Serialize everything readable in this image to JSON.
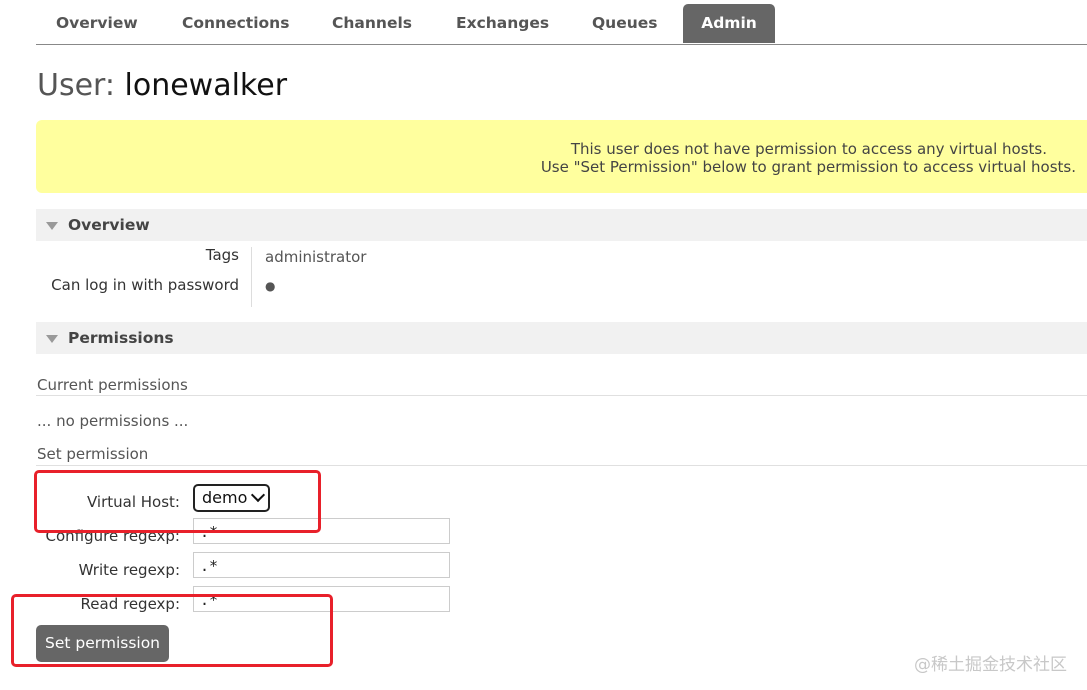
{
  "nav": {
    "tabs": [
      "Overview",
      "Connections",
      "Channels",
      "Exchanges",
      "Queues",
      "Admin"
    ],
    "active": "Admin"
  },
  "page_title": {
    "label": "User:",
    "value": "lonewalker"
  },
  "warning": {
    "line1": "This user does not have permission to access any virtual hosts.",
    "line2": "Use \"Set Permission\" below to grant permission to access virtual hosts."
  },
  "overview": {
    "header": "Overview",
    "tags_label": "Tags",
    "tags_value": "administrator",
    "login_label": "Can log in with password",
    "login_value": "●"
  },
  "permissions": {
    "header": "Permissions",
    "current_label": "Current permissions",
    "no_permissions": "... no permissions ...",
    "set_label": "Set permission",
    "vhost_label": "Virtual Host:",
    "vhost_value": "demo",
    "configure_label": "Configure regexp:",
    "configure_value": ".*",
    "write_label": "Write regexp:",
    "write_value": ".*",
    "read_label": "Read regexp:",
    "read_value": ".*",
    "button": "Set permission"
  },
  "watermark": "@稀土掘金技术社区",
  "colors": {
    "accent_tab": "#666666",
    "warning_bg": "#ffff9e",
    "highlight": "#e8202a"
  }
}
